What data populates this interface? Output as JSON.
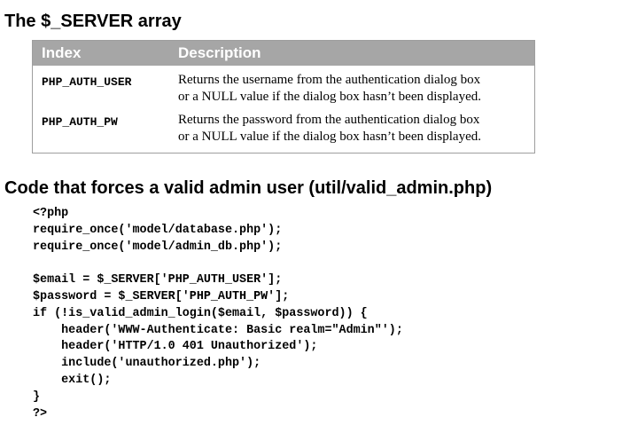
{
  "section1": {
    "title": "The $_SERVER array",
    "table": {
      "headers": [
        "Index",
        "Description"
      ],
      "rows": [
        {
          "index": "PHP_AUTH_USER",
          "description": [
            "Returns the username from the authentication dialog box",
            "or a NULL value if the dialog box hasn’t been displayed."
          ]
        },
        {
          "index": "PHP_AUTH_PW",
          "description": [
            "Returns the password from the authentication dialog box",
            "or a NULL value if the dialog box hasn’t been displayed."
          ]
        }
      ]
    }
  },
  "section2": {
    "title": "Code that forces a valid admin user (util/valid_admin.php)",
    "code_lines": [
      "<?php",
      "require_once('model/database.php');",
      "require_once('model/admin_db.php');",
      "",
      "$email = $_SERVER['PHP_AUTH_USER'];",
      "$password = $_SERVER['PHP_AUTH_PW'];",
      "if (!is_valid_admin_login($email, $password)) {",
      "    header('WWW-Authenticate: Basic realm=\"Admin\"');",
      "    header('HTTP/1.0 401 Unauthorized');",
      "    include('unauthorized.php');",
      "    exit();",
      "}",
      "?>"
    ]
  }
}
